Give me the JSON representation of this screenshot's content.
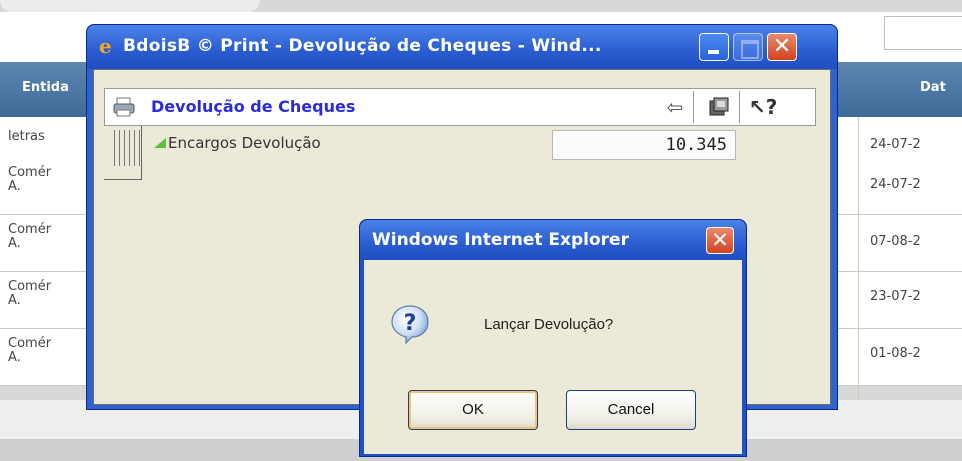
{
  "background": {
    "headers": {
      "entidade": "Entida",
      "data": "Dat"
    },
    "rows": [
      {
        "entidade_l1": "letras",
        "entidade_l2": "",
        "data": "24-07-2"
      },
      {
        "entidade_l1": "Comér",
        "entidade_l2": "A.",
        "data": "24-07-2"
      },
      {
        "entidade_l1": "Comér",
        "entidade_l2": "A.",
        "data": "07-08-2"
      },
      {
        "entidade_l1": "Comér",
        "entidade_l2": "A.",
        "data": "23-07-2"
      },
      {
        "entidade_l1": "Comér",
        "entidade_l2": "A.",
        "data": "01-08-2"
      }
    ]
  },
  "popup": {
    "window_title": "BdoisB © Print - Devolução de Cheques - Wind...",
    "panel_title": "Devolução de Cheques",
    "toolbar": {
      "back_icon": "back-arrow-icon",
      "print_icon": "print-icon",
      "help_icon": "help-cursor-icon"
    },
    "field": {
      "label": "Encargos Devolução",
      "value": "10.345"
    }
  },
  "alert": {
    "title": "Windows Internet Explorer",
    "message": "Lançar Devolução?",
    "ok_label": "OK",
    "cancel_label": "Cancel"
  },
  "colors": {
    "titlebar_blue": "#2a5cd0",
    "header_blue": "#4a76a4",
    "panel_title": "#2a2ad8",
    "close_red": "#d1431f"
  }
}
